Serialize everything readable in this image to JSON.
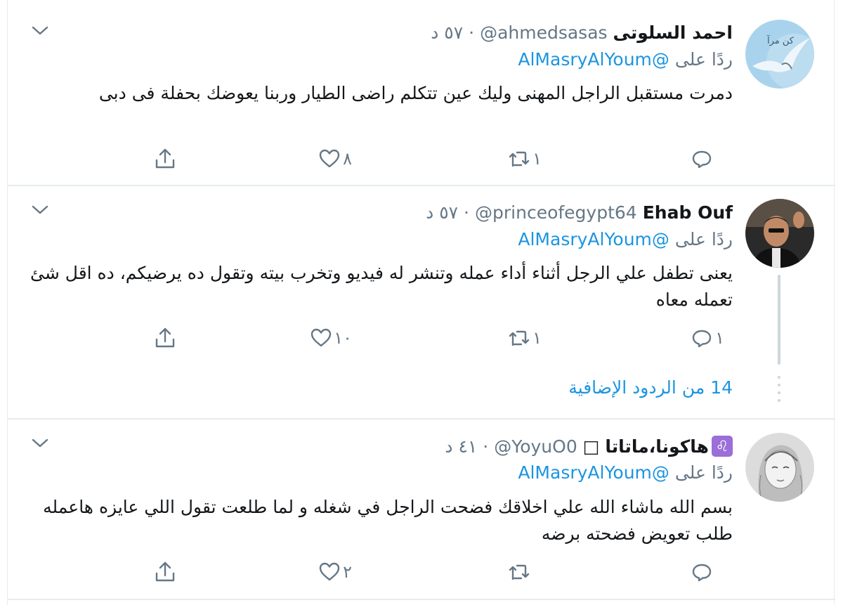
{
  "tweets": [
    {
      "display_name": "احمد السلوتى",
      "handle": "@ahmedsasas",
      "meta": "· ٥٧ د",
      "reply_prefix": "ردًا على",
      "reply_mention": "@AlMasryAlYoum",
      "text": "دمرت مستقبل الراجل المهنى وليك عين تتكلم راضى الطيار وربنا يعوضك بحفلة فى دبى",
      "reply_count": "",
      "retweet_count": "١",
      "like_count": "٨"
    },
    {
      "display_name": "Ehab Ouf",
      "handle": "@princeofegypt64",
      "meta": "· ٥٧ د",
      "reply_prefix": "ردًا على",
      "reply_mention": "@AlMasryAlYoum",
      "text": "يعنى تطفل علي الرجل أثناء أداء عمله وتنشر له فيديو وتخرب بيته وتقول ده يرضيكم، ده اقل شئ تعمله معاه",
      "reply_count": "١",
      "retweet_count": "١",
      "like_count": "١٠"
    },
    {
      "display_name": "هاكونا،ماتاتا",
      "name_prefix_emoji": "♌",
      "name_suffix": "□",
      "handle": "@YoyuO0",
      "meta": "· ٤١ د",
      "reply_prefix": "ردًا على",
      "reply_mention": "@AlMasryAlYoum",
      "text": "بسم الله ماشاء الله علي اخلاقك فضحت الراجل في شغله و لما طلعت تقول اللي عايزه هاعمله طلب تعويض فضحته برضه",
      "reply_count": "",
      "retweet_count": "",
      "like_count": "٢"
    }
  ],
  "more_replies": "14 من الردود الإضافية",
  "avatar_1_text": "كن مرآ",
  "colors": {
    "accent": "#1b95e0",
    "secondary_text": "#657786",
    "border": "#e6ecf0",
    "thread_line": "#ccd6dd"
  },
  "icons": [
    "caret-down-icon",
    "reply-icon",
    "retweet-icon",
    "like-icon",
    "share-icon"
  ]
}
